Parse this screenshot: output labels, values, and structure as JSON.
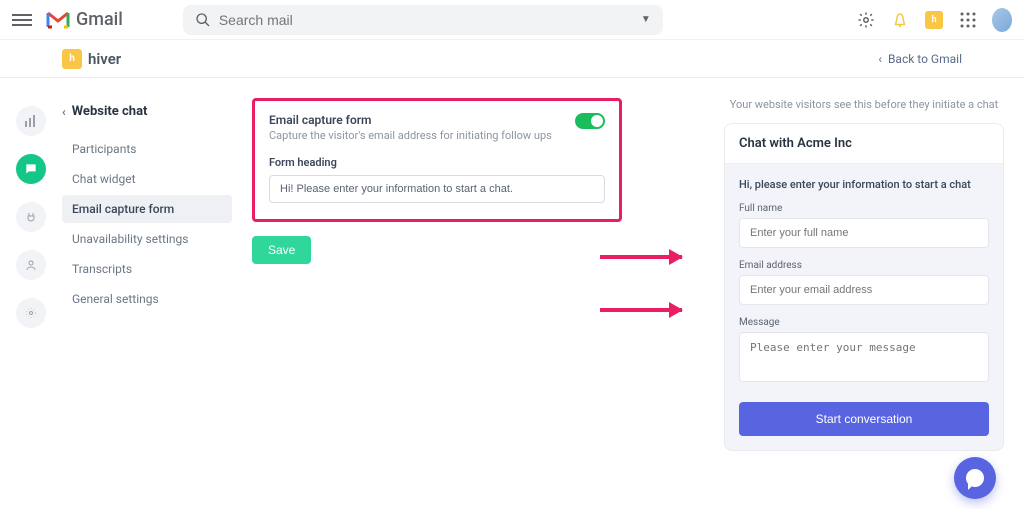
{
  "gmail": {
    "label": "Gmail",
    "search_placeholder": "Search mail"
  },
  "hiver": {
    "brand": "hiver",
    "back_link": "Back to Gmail"
  },
  "sidebar": {
    "title": "Website chat",
    "items": [
      {
        "label": "Participants"
      },
      {
        "label": "Chat widget"
      },
      {
        "label": "Email capture form"
      },
      {
        "label": "Unavailability settings"
      },
      {
        "label": "Transcripts"
      },
      {
        "label": "General settings"
      }
    ]
  },
  "form": {
    "title": "Email capture form",
    "subtitle": "Capture the visitor's email address for initiating follow ups",
    "heading_label": "Form heading",
    "heading_value": "Hi! Please enter your information to start a chat.",
    "save_label": "Save"
  },
  "preview": {
    "hint": "Your website visitors see this before they initiate a chat",
    "header": "Chat with Acme Inc",
    "intro": "Hi, please enter your information to start a chat",
    "fullname_label": "Full name",
    "fullname_placeholder": "Enter your full name",
    "email_label": "Email address",
    "email_placeholder": "Enter your email address",
    "message_label": "Message",
    "message_placeholder": "Please enter your message",
    "start_label": "Start conversation"
  }
}
